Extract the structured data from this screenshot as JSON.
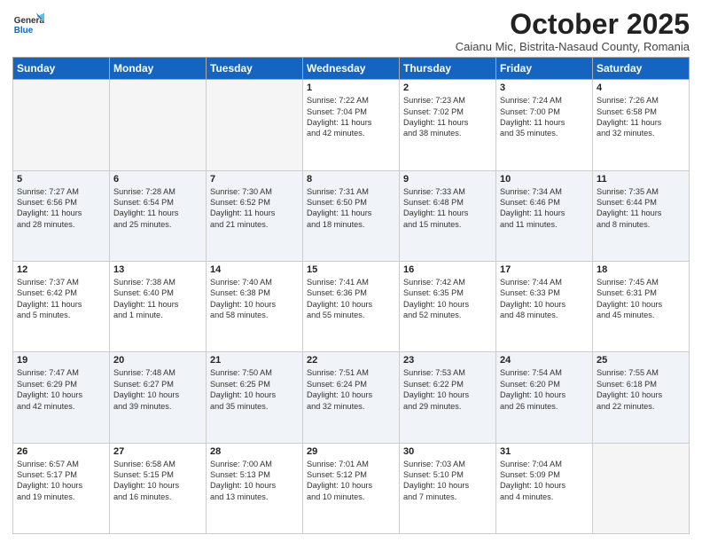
{
  "header": {
    "logo_general": "General",
    "logo_blue": "Blue",
    "title": "October 2025",
    "subtitle": "Caianu Mic, Bistrita-Nasaud County, Romania"
  },
  "days_of_week": [
    "Sunday",
    "Monday",
    "Tuesday",
    "Wednesday",
    "Thursday",
    "Friday",
    "Saturday"
  ],
  "weeks": [
    [
      {
        "day": "",
        "lines": [],
        "empty": true
      },
      {
        "day": "",
        "lines": [],
        "empty": true
      },
      {
        "day": "",
        "lines": [],
        "empty": true
      },
      {
        "day": "1",
        "lines": [
          "Sunrise: 7:22 AM",
          "Sunset: 7:04 PM",
          "Daylight: 11 hours",
          "and 42 minutes."
        ],
        "empty": false
      },
      {
        "day": "2",
        "lines": [
          "Sunrise: 7:23 AM",
          "Sunset: 7:02 PM",
          "Daylight: 11 hours",
          "and 38 minutes."
        ],
        "empty": false
      },
      {
        "day": "3",
        "lines": [
          "Sunrise: 7:24 AM",
          "Sunset: 7:00 PM",
          "Daylight: 11 hours",
          "and 35 minutes."
        ],
        "empty": false
      },
      {
        "day": "4",
        "lines": [
          "Sunrise: 7:26 AM",
          "Sunset: 6:58 PM",
          "Daylight: 11 hours",
          "and 32 minutes."
        ],
        "empty": false
      }
    ],
    [
      {
        "day": "5",
        "lines": [
          "Sunrise: 7:27 AM",
          "Sunset: 6:56 PM",
          "Daylight: 11 hours",
          "and 28 minutes."
        ],
        "empty": false
      },
      {
        "day": "6",
        "lines": [
          "Sunrise: 7:28 AM",
          "Sunset: 6:54 PM",
          "Daylight: 11 hours",
          "and 25 minutes."
        ],
        "empty": false
      },
      {
        "day": "7",
        "lines": [
          "Sunrise: 7:30 AM",
          "Sunset: 6:52 PM",
          "Daylight: 11 hours",
          "and 21 minutes."
        ],
        "empty": false
      },
      {
        "day": "8",
        "lines": [
          "Sunrise: 7:31 AM",
          "Sunset: 6:50 PM",
          "Daylight: 11 hours",
          "and 18 minutes."
        ],
        "empty": false
      },
      {
        "day": "9",
        "lines": [
          "Sunrise: 7:33 AM",
          "Sunset: 6:48 PM",
          "Daylight: 11 hours",
          "and 15 minutes."
        ],
        "empty": false
      },
      {
        "day": "10",
        "lines": [
          "Sunrise: 7:34 AM",
          "Sunset: 6:46 PM",
          "Daylight: 11 hours",
          "and 11 minutes."
        ],
        "empty": false
      },
      {
        "day": "11",
        "lines": [
          "Sunrise: 7:35 AM",
          "Sunset: 6:44 PM",
          "Daylight: 11 hours",
          "and 8 minutes."
        ],
        "empty": false
      }
    ],
    [
      {
        "day": "12",
        "lines": [
          "Sunrise: 7:37 AM",
          "Sunset: 6:42 PM",
          "Daylight: 11 hours",
          "and 5 minutes."
        ],
        "empty": false
      },
      {
        "day": "13",
        "lines": [
          "Sunrise: 7:38 AM",
          "Sunset: 6:40 PM",
          "Daylight: 11 hours",
          "and 1 minute."
        ],
        "empty": false
      },
      {
        "day": "14",
        "lines": [
          "Sunrise: 7:40 AM",
          "Sunset: 6:38 PM",
          "Daylight: 10 hours",
          "and 58 minutes."
        ],
        "empty": false
      },
      {
        "day": "15",
        "lines": [
          "Sunrise: 7:41 AM",
          "Sunset: 6:36 PM",
          "Daylight: 10 hours",
          "and 55 minutes."
        ],
        "empty": false
      },
      {
        "day": "16",
        "lines": [
          "Sunrise: 7:42 AM",
          "Sunset: 6:35 PM",
          "Daylight: 10 hours",
          "and 52 minutes."
        ],
        "empty": false
      },
      {
        "day": "17",
        "lines": [
          "Sunrise: 7:44 AM",
          "Sunset: 6:33 PM",
          "Daylight: 10 hours",
          "and 48 minutes."
        ],
        "empty": false
      },
      {
        "day": "18",
        "lines": [
          "Sunrise: 7:45 AM",
          "Sunset: 6:31 PM",
          "Daylight: 10 hours",
          "and 45 minutes."
        ],
        "empty": false
      }
    ],
    [
      {
        "day": "19",
        "lines": [
          "Sunrise: 7:47 AM",
          "Sunset: 6:29 PM",
          "Daylight: 10 hours",
          "and 42 minutes."
        ],
        "empty": false
      },
      {
        "day": "20",
        "lines": [
          "Sunrise: 7:48 AM",
          "Sunset: 6:27 PM",
          "Daylight: 10 hours",
          "and 39 minutes."
        ],
        "empty": false
      },
      {
        "day": "21",
        "lines": [
          "Sunrise: 7:50 AM",
          "Sunset: 6:25 PM",
          "Daylight: 10 hours",
          "and 35 minutes."
        ],
        "empty": false
      },
      {
        "day": "22",
        "lines": [
          "Sunrise: 7:51 AM",
          "Sunset: 6:24 PM",
          "Daylight: 10 hours",
          "and 32 minutes."
        ],
        "empty": false
      },
      {
        "day": "23",
        "lines": [
          "Sunrise: 7:53 AM",
          "Sunset: 6:22 PM",
          "Daylight: 10 hours",
          "and 29 minutes."
        ],
        "empty": false
      },
      {
        "day": "24",
        "lines": [
          "Sunrise: 7:54 AM",
          "Sunset: 6:20 PM",
          "Daylight: 10 hours",
          "and 26 minutes."
        ],
        "empty": false
      },
      {
        "day": "25",
        "lines": [
          "Sunrise: 7:55 AM",
          "Sunset: 6:18 PM",
          "Daylight: 10 hours",
          "and 22 minutes."
        ],
        "empty": false
      }
    ],
    [
      {
        "day": "26",
        "lines": [
          "Sunrise: 6:57 AM",
          "Sunset: 5:17 PM",
          "Daylight: 10 hours",
          "and 19 minutes."
        ],
        "empty": false
      },
      {
        "day": "27",
        "lines": [
          "Sunrise: 6:58 AM",
          "Sunset: 5:15 PM",
          "Daylight: 10 hours",
          "and 16 minutes."
        ],
        "empty": false
      },
      {
        "day": "28",
        "lines": [
          "Sunrise: 7:00 AM",
          "Sunset: 5:13 PM",
          "Daylight: 10 hours",
          "and 13 minutes."
        ],
        "empty": false
      },
      {
        "day": "29",
        "lines": [
          "Sunrise: 7:01 AM",
          "Sunset: 5:12 PM",
          "Daylight: 10 hours",
          "and 10 minutes."
        ],
        "empty": false
      },
      {
        "day": "30",
        "lines": [
          "Sunrise: 7:03 AM",
          "Sunset: 5:10 PM",
          "Daylight: 10 hours",
          "and 7 minutes."
        ],
        "empty": false
      },
      {
        "day": "31",
        "lines": [
          "Sunrise: 7:04 AM",
          "Sunset: 5:09 PM",
          "Daylight: 10 hours",
          "and 4 minutes."
        ],
        "empty": false
      },
      {
        "day": "",
        "lines": [],
        "empty": true
      }
    ]
  ]
}
